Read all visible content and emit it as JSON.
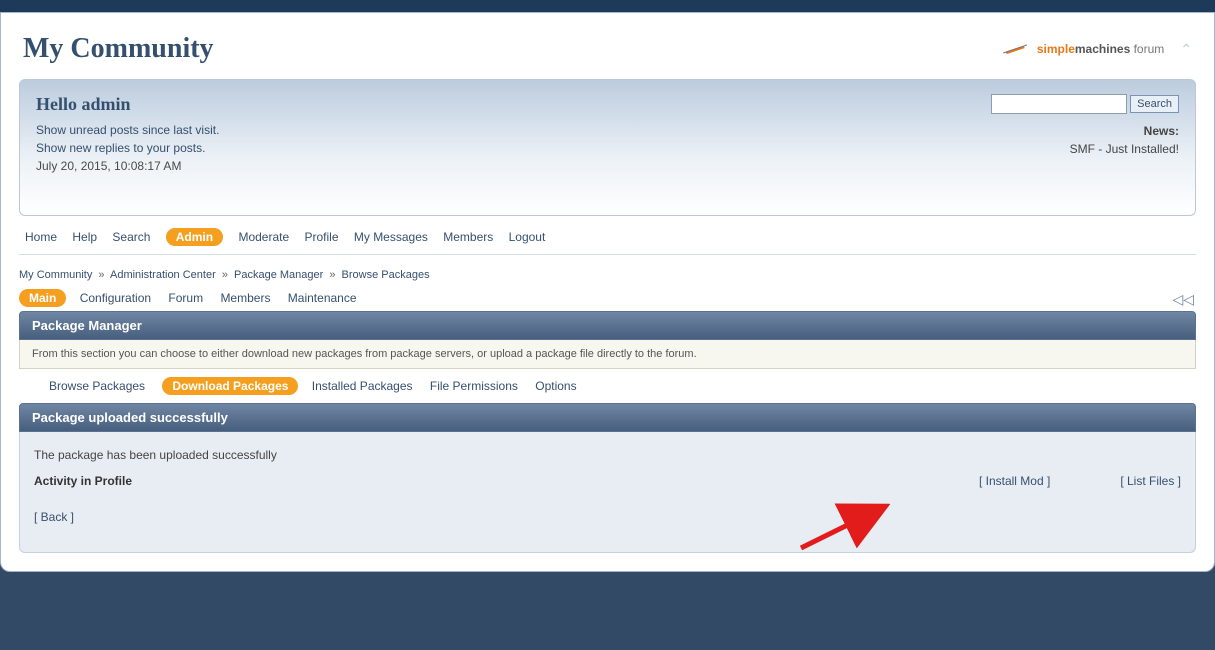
{
  "site_title": "My Community",
  "logo": {
    "simple": "simple",
    "machines": "machines",
    "forum": " forum"
  },
  "user": {
    "hello": "Hello admin",
    "unread": "Show unread posts since last visit.",
    "replies": "Show new replies to your posts.",
    "datetime": "July 20, 2015, 10:08:17 AM"
  },
  "search": {
    "button": "Search",
    "value": ""
  },
  "news": {
    "label": "News:",
    "text": "SMF - Just Installed!"
  },
  "mainmenu": {
    "home": "Home",
    "help": "Help",
    "search": "Search",
    "admin": "Admin",
    "moderate": "Moderate",
    "profile": "Profile",
    "messages": "My Messages",
    "members": "Members",
    "logout": "Logout"
  },
  "breadcrumb": {
    "a": "My Community",
    "b": "Administration Center",
    "c": "Package Manager",
    "d": "Browse Packages",
    "sep": "»"
  },
  "admintabs": {
    "main": "Main",
    "config": "Configuration",
    "forum": "Forum",
    "members": "Members",
    "maint": "Maintenance"
  },
  "titlebar1": "Package Manager",
  "infobar": "From this section you can choose to either download new packages from package servers, or upload a package file directly to the forum.",
  "subtabs": {
    "browse": "Browse Packages",
    "download": "Download Packages",
    "installed": "Installed Packages",
    "perms": "File Permissions",
    "options": "Options"
  },
  "titlebar2": "Package uploaded successfully",
  "content": {
    "uploaded": "The package has been uploaded successfully",
    "pkg_name": "Activity in Profile",
    "install": "[ Install Mod ]",
    "list": "[ List Files ]",
    "back": "[ Back ]"
  }
}
